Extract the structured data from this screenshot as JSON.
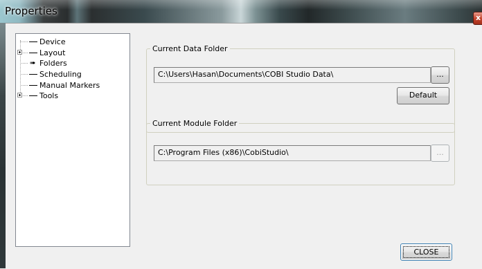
{
  "window": {
    "title": "Properties",
    "close_glyph": "x"
  },
  "tree": {
    "items": [
      {
        "label": "Device",
        "expandable": false,
        "selected": false
      },
      {
        "label": "Layout",
        "expandable": true,
        "selected": false
      },
      {
        "label": "Folders",
        "expandable": false,
        "selected": true
      },
      {
        "label": "Scheduling",
        "expandable": false,
        "selected": false
      },
      {
        "label": "Manual Markers",
        "expandable": false,
        "selected": false
      },
      {
        "label": "Tools",
        "expandable": true,
        "selected": false
      }
    ]
  },
  "data_folder": {
    "legend": "Current Data Folder",
    "path": "C:\\Users\\Hasan\\Documents\\COBI Studio Data\\",
    "browse_label": "...",
    "default_label": "Default"
  },
  "module_folder": {
    "legend": "Current Module Folder",
    "path": "C:\\Program Files (x86)\\CobiStudio\\",
    "browse_label": "..."
  },
  "footer": {
    "close_label": "CLOSE"
  },
  "colors": {
    "title_glass": "#2a2e2f",
    "close_red": "#c2412a",
    "dialog_bg": "#f0f0f0"
  },
  "icons": {
    "selected_marker": "arrow-right-icon",
    "expand": "plus-box-icon"
  }
}
